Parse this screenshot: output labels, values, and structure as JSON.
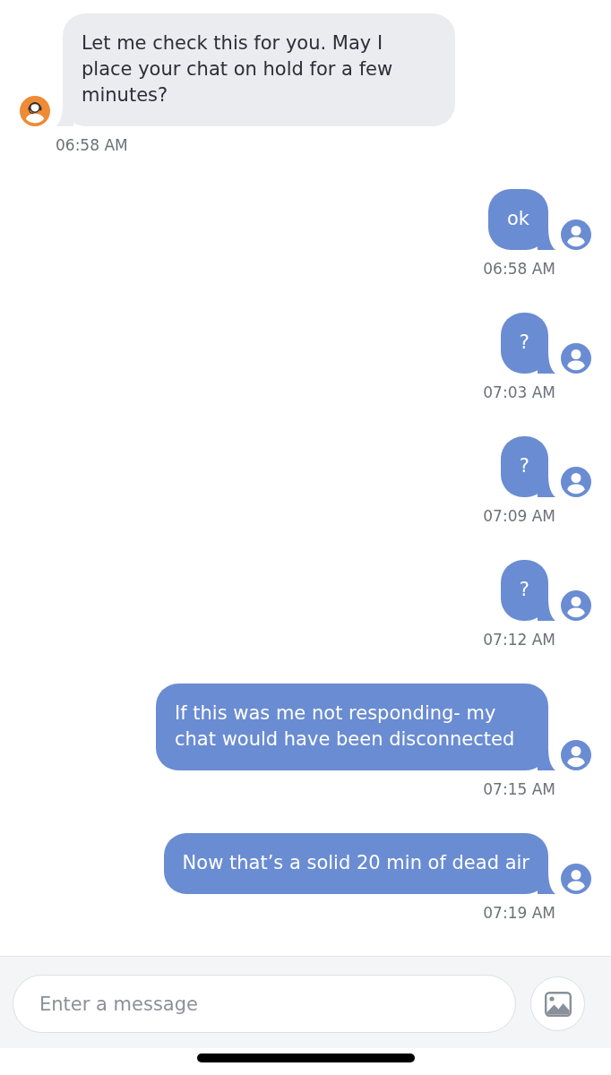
{
  "messages": [
    {
      "kind": "agent",
      "text": "Let me check this for you. May I place your chat on hold for a few minutes?",
      "time": "06:58 AM"
    },
    {
      "kind": "user",
      "text": "ok",
      "time": "06:58 AM"
    },
    {
      "kind": "user",
      "text": "?",
      "time": "07:03 AM"
    },
    {
      "kind": "user",
      "text": "?",
      "time": "07:09 AM"
    },
    {
      "kind": "user",
      "text": "?",
      "time": "07:12 AM"
    },
    {
      "kind": "user",
      "text": "If this was me not responding- my chat would have been disconnected",
      "time": "07:15 AM"
    },
    {
      "kind": "user",
      "text": "Now that’s a solid 20 min of dead air",
      "time": "07:19 AM"
    }
  ],
  "composer": {
    "placeholder": "Enter a message"
  }
}
